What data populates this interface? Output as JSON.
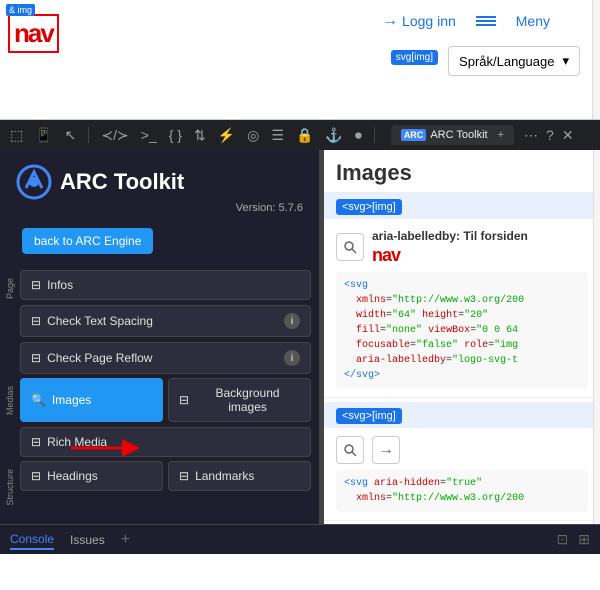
{
  "webpage": {
    "nav_img_label": "& img",
    "svg_img_label": "svg[img]",
    "login_label": "Logg inn",
    "menu_label": "Meny",
    "language_label": "Språk/Language",
    "nav_logo": "nav"
  },
  "devtools": {
    "arc_tab_label": "ARC Toolkit",
    "arc_tab_close": "×",
    "more_options": "⋯",
    "help": "?",
    "close": "×"
  },
  "arc_panel": {
    "title": "ARC Toolkit",
    "version": "Version: 5.7.6",
    "back_button": "back to ARC Engine",
    "page_label": "Page",
    "medias_label": "Medias",
    "structure_label": "Structure",
    "buttons": {
      "infos": "Infos",
      "check_text_spacing": "Check Text Spacing",
      "check_page_reflow": "Check Page Reflow",
      "images": "Images",
      "background_images": "Background images",
      "rich_media": "Rich Media",
      "headings": "Headings",
      "landmarks": "Landmarks"
    }
  },
  "images_panel": {
    "title": "Images",
    "svg_badge1": "<svg>[img]",
    "svg_badge2": "<svg>[img]",
    "item1": {
      "aria_label_prefix": "aria-labelledby:",
      "aria_label_value": "Til forsiden",
      "nav_logo": "nav",
      "code": "<svg\n  xmlns=\"http://www.w3.org/200\n  width=\"64\" height=\"20\"\n  fill=\"none\" viewBox=\"0 0 64\n  focusable=\"false\" role=\"img\n  aria-labelledby=\"logo-svg-t\n</svg>"
    },
    "item2": {
      "code": "<svg aria-hidden=\"true\"\n  xmlns=\"http://www.w3.org/200"
    }
  },
  "console": {
    "tabs": [
      "Console",
      "Issues"
    ],
    "active_tab": "Issues",
    "add_icon": "+"
  }
}
